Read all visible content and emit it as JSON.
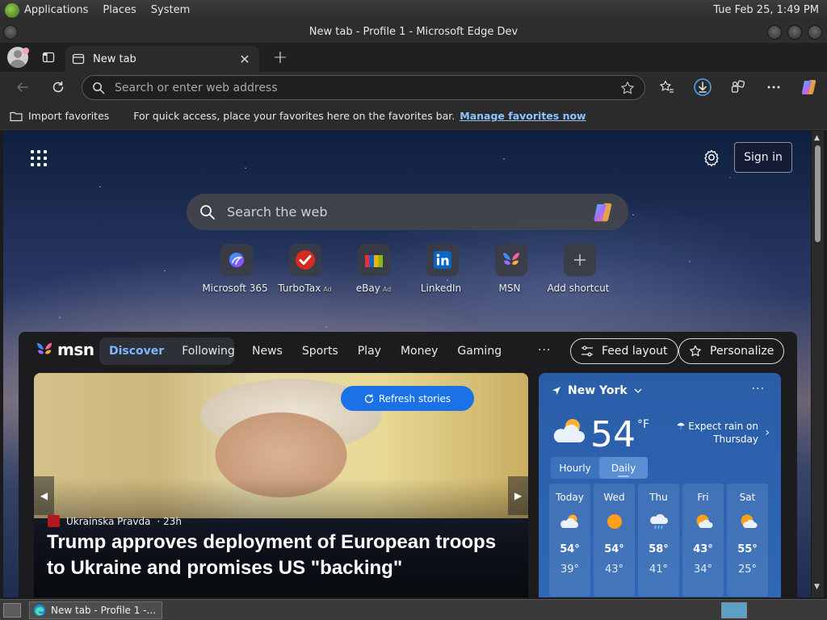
{
  "panel": {
    "applications": "Applications",
    "places": "Places",
    "system": "System",
    "clock": "Tue Feb 25,  1:49 PM"
  },
  "window": {
    "title": "New tab - Profile 1 - Microsoft Edge Dev"
  },
  "tabs": {
    "active_tab_title": "New tab",
    "close_glyph": "✕",
    "new_tab_glyph": "+"
  },
  "address_bar": {
    "placeholder": "Search or enter web address",
    "value": ""
  },
  "favorites_bar": {
    "import_label": "Import favorites",
    "hint": "For quick access, place your favorites here on the favorites bar.",
    "manage_link": "Manage favorites now"
  },
  "ntp": {
    "sign_in": "Sign in",
    "search_placeholder": "Search the web",
    "shortcuts": [
      {
        "label": "Microsoft 365",
        "ad": ""
      },
      {
        "label": "TurboTax",
        "ad": "Ad"
      },
      {
        "label": "eBay",
        "ad": "Ad"
      },
      {
        "label": "LinkedIn",
        "ad": ""
      },
      {
        "label": "MSN",
        "ad": ""
      },
      {
        "label": "Add shortcut",
        "ad": ""
      }
    ]
  },
  "msn": {
    "logo_text": "msn",
    "tab_discover": "Discover",
    "tab_following": "Following",
    "nav": [
      "News",
      "Sports",
      "Play",
      "Money",
      "Gaming"
    ],
    "more": "···",
    "feed_layout": "Feed layout",
    "personalize": "Personalize"
  },
  "hero": {
    "refresh_label": "Refresh stories",
    "source": "Ukrainska Pravda",
    "age": "· 23h",
    "headline": "Trump approves deployment of European troops to Ukraine and promises US \"backing\"",
    "prev": "◀",
    "next": "▶"
  },
  "weather": {
    "location": "New York",
    "more": "···",
    "current_temp": "54",
    "unit": "°F",
    "alert_line1": "Expect rain on",
    "alert_line2": "Thursday",
    "toggle_hourly": "Hourly",
    "toggle_daily": "Daily",
    "days": [
      {
        "name": "Today",
        "hi": "54°",
        "lo": "39°",
        "icon": "partly-cloudy-icon"
      },
      {
        "name": "Wed",
        "hi": "54°",
        "lo": "43°",
        "icon": "sunny-icon"
      },
      {
        "name": "Thu",
        "hi": "58°",
        "lo": "41°",
        "icon": "rain-icon"
      },
      {
        "name": "Fri",
        "hi": "43°",
        "lo": "34°",
        "icon": "partly-sunny-icon"
      },
      {
        "name": "Sat",
        "hi": "55°",
        "lo": "25°",
        "icon": "partly-sunny-icon"
      }
    ]
  },
  "taskbar": {
    "task_label": "New tab - Profile 1 -..."
  },
  "colors": {
    "accent_link": "#8ec3ff",
    "msn_active": "#7eb6ff",
    "refresh_button": "#1a72e6",
    "weather_card": "#2f68b5"
  }
}
